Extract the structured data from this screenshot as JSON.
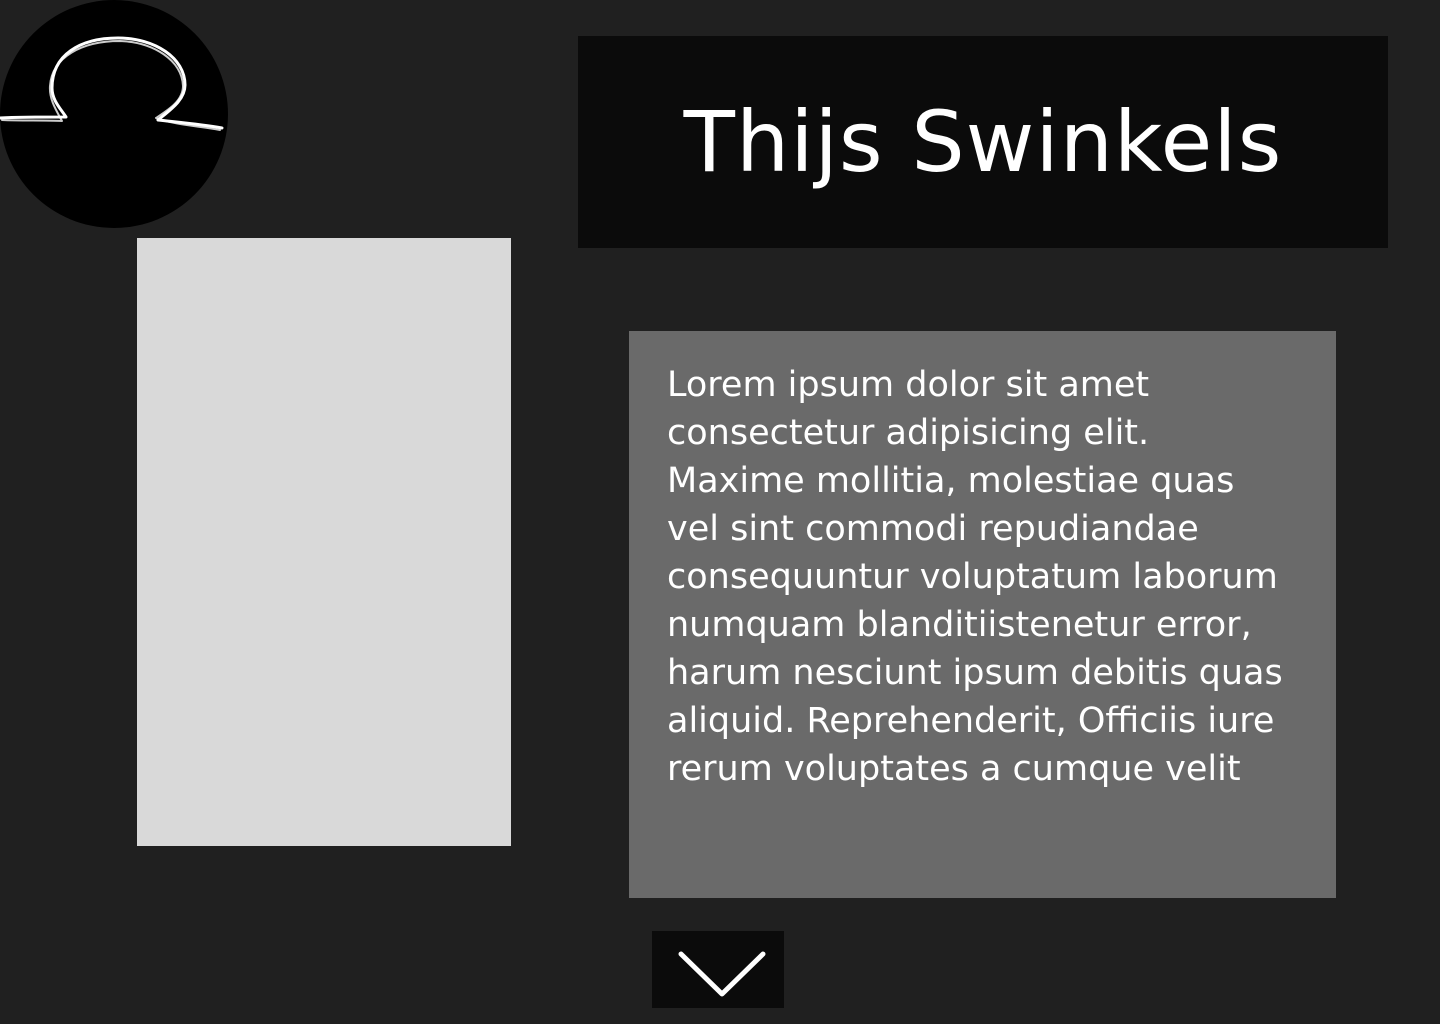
{
  "colors": {
    "page_background": "#202020",
    "logo_background": "#000000",
    "photo_placeholder": "#d9d9d9",
    "title_background": "#0b0b0b",
    "text_box_background": "#6a6a6a",
    "text": "#ffffff"
  },
  "header": {
    "logo_icon": "head-outline-icon",
    "title": "Thijs Swinkels"
  },
  "main": {
    "photo": "image-placeholder",
    "body_text": "Lorem ipsum dolor sit amet consectetur adipisicing elit. Maxime mollitia, molestiae quas vel sint commodi repudiandae consequuntur voluptatum laborum numquam blanditiistenetur error, harum nesciunt ipsum debitis quas aliquid. Reprehenderit, Officiis iure rerum voluptates a cumque velit"
  },
  "footer": {
    "scroll_icon": "chevron-down-icon"
  }
}
